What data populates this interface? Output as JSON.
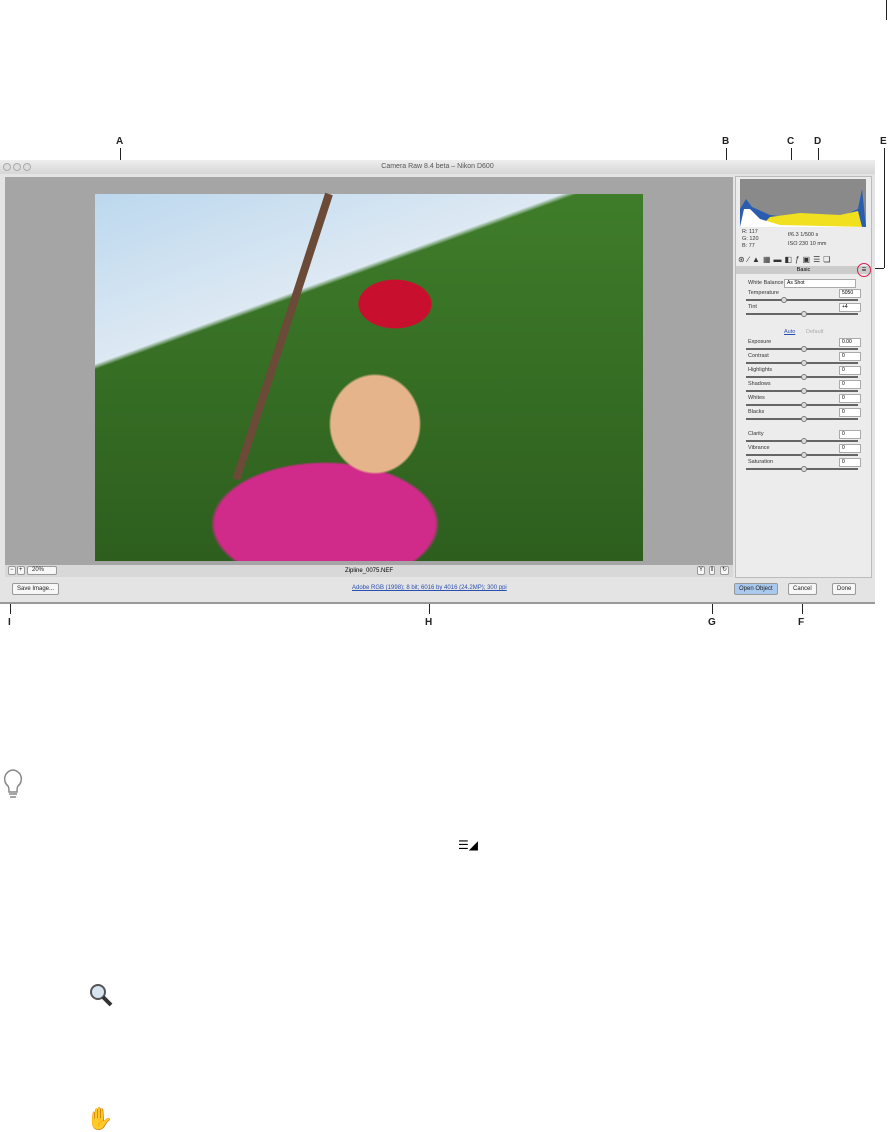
{
  "callouts": [
    "A",
    "B",
    "C",
    "D",
    "E",
    "F",
    "G",
    "H",
    "I"
  ],
  "window": {
    "title": "Camera Raw 8.4 beta  –  Nikon D600",
    "tools": [
      "zoom-tool",
      "hand-tool",
      "white-balance-tool",
      "color-sampler-tool",
      "targeted-adjustment-tool",
      "crop-tool",
      "straighten-tool",
      "spot-removal-tool",
      "red-eye-tool",
      "adjustment-brush",
      "graduated-filter",
      "radial-filter",
      "preferences",
      "rotate-left",
      "rotate-right"
    ],
    "filename": "Zipline_0075.NEF",
    "zoom": "20%",
    "workflow_link": "Adobe RGB (1998); 8 bit; 6016 by 4016 (24.2MP); 300 ppi",
    "buttons": {
      "save": "Save Image...",
      "open": "Open Object",
      "cancel": "Cancel",
      "done": "Done"
    }
  },
  "readout": {
    "r": "R:  117",
    "g": "G:  120",
    "b": "B:   77",
    "aperture": "f/6.3   1/500 s",
    "iso": "ISO 230   10 mm"
  },
  "panel": {
    "tab_title": "Basic",
    "wb_label": "White Balance:",
    "wb_value": "As Shot",
    "auto": "Auto",
    "default": "Default",
    "sliders": [
      {
        "label": "Temperature",
        "value": "5050"
      },
      {
        "label": "Tint",
        "value": "+4"
      },
      {
        "label": "Exposure",
        "value": "0.00"
      },
      {
        "label": "Contrast",
        "value": "0"
      },
      {
        "label": "Highlights",
        "value": "0"
      },
      {
        "label": "Shadows",
        "value": "0"
      },
      {
        "label": "Whites",
        "value": "0"
      },
      {
        "label": "Blacks",
        "value": "0"
      },
      {
        "label": "Clarity",
        "value": "0"
      },
      {
        "label": "Vibrance",
        "value": "0"
      },
      {
        "label": "Saturation",
        "value": "0"
      }
    ]
  },
  "accent": "#d3204f"
}
